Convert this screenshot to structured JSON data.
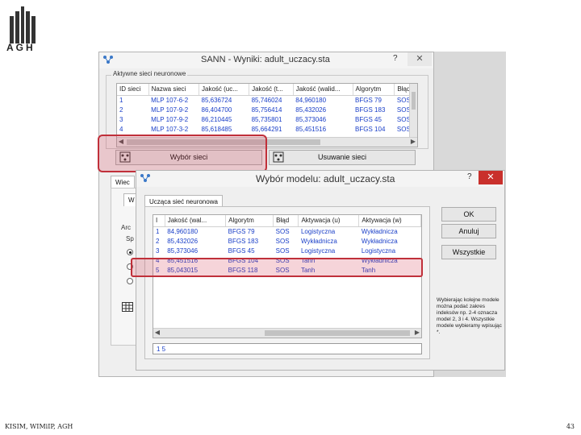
{
  "logo": {
    "text": "AGH"
  },
  "footer": {
    "left": "KISIM, WIMiIP, AGH",
    "page": "43"
  },
  "main_window": {
    "title": "SANN - Wyniki: adult_uczacy.sta",
    "help_label": "?",
    "close_label": "✕",
    "group_title": "Aktywne sieci neuronowe",
    "columns": [
      "ID sieci",
      "Nazwa sieci",
      "Jakość (uc...",
      "Jakość (t...",
      "Jakość (walid...",
      "Algorytm",
      "Błąd"
    ],
    "rows": [
      [
        "1",
        "MLP 107-6-2",
        "85,636724",
        "85,746024",
        "84,960180",
        "BFGS 79",
        "SOS"
      ],
      [
        "2",
        "MLP 107-9-2",
        "86,404700",
        "85,756414",
        "85,432026",
        "BFGS 183",
        "SOS"
      ],
      [
        "3",
        "MLP 107-9-2",
        "86,210445",
        "85,735801",
        "85,373046",
        "BFGS 45",
        "SOS"
      ],
      [
        "4",
        "MLP 107-3-2",
        "85,618485",
        "85,664291",
        "85,451516",
        "BFGS 104",
        "SOS"
      ]
    ],
    "select_button": "Wybór sieci",
    "delete_button": "Usuwanie sieci",
    "side_tab_1": "Wiec",
    "side_tab_2": "W",
    "side_label_1": "Arc",
    "side_label_2": "Sp"
  },
  "dialog": {
    "title": "Wybór modelu: adult_uczacy.sta",
    "help_label": "?",
    "close_label": "✕",
    "tab_label": "Ucząca sieć neuronowa",
    "columns": [
      "I",
      "Jakość (wal...",
      "Algorytm",
      "Błąd",
      "Aktywacja (u)",
      "Aktywacja (w)"
    ],
    "rows": [
      [
        "1",
        "84,960180",
        "BFGS 79",
        "SOS",
        "Logistyczna",
        "Wykładnicza"
      ],
      [
        "2",
        "85,432026",
        "BFGS 183",
        "SOS",
        "Wykładnicza",
        "Wykładnicza"
      ],
      [
        "3",
        "85,373046",
        "BFGS 45",
        "SOS",
        "Logistyczna",
        "Logistyczna"
      ],
      [
        "4",
        "85,451516",
        "BFGS 104",
        "SOS",
        "Tanh",
        "Wykładnicza"
      ],
      [
        "5",
        "85,043015",
        "BFGS 118",
        "SOS",
        "Tanh",
        "Tanh"
      ]
    ],
    "selection_value": "1 5",
    "ok_button": "OK",
    "cancel_button": "Anuluj",
    "all_button": "Wszystkie",
    "hint_text": "Wybierając kolejne modele można podać zakres indeksów np. 2-4 oznacza model 2, 3 i 4. Wszystkie modele wybieramy wpisując *."
  },
  "colors": {
    "highlight": "#c0303a",
    "close_button": "#c9302c",
    "link_text": "#1a3fc8"
  }
}
